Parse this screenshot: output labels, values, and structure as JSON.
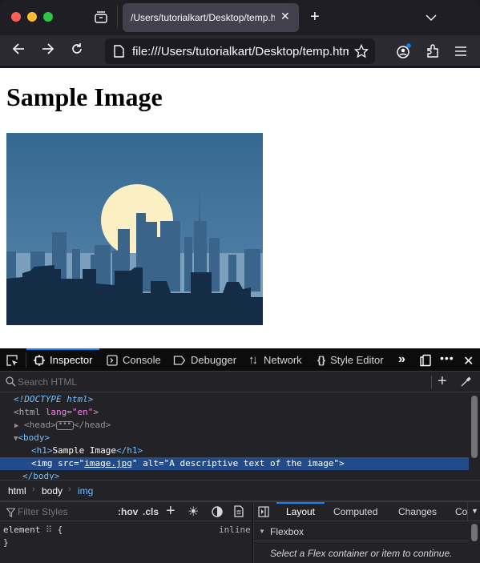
{
  "browser": {
    "tab": {
      "title": "/Users/tutorialkart/Desktop/temp.html"
    },
    "url": "file:///Users/tutorialkart/Desktop/temp.html",
    "traffic_lights": {
      "close": "#ff5f57",
      "minimize": "#febc2e",
      "zoom": "#28c840"
    },
    "icons": [
      "tab-groups-icon",
      "close-icon",
      "new-tab-icon",
      "list-all-tabs-icon",
      "back-icon",
      "forward-icon",
      "reload-icon",
      "page-icon",
      "bookmark-star-icon",
      "account-icon",
      "extensions-icon",
      "menu-icon"
    ],
    "account_badge_color": "#0a84ff"
  },
  "page": {
    "heading": "Sample Image",
    "image_alt": "A descriptive text of the image",
    "image_colors": {
      "sky": "#3c6a8f",
      "moon": "#fbf0c3",
      "buildings": "#2d5478",
      "foreground": "#142c45"
    }
  },
  "devtools": {
    "tabs": [
      {
        "label": "Inspector",
        "selected": true
      },
      {
        "label": "Console"
      },
      {
        "label": "Debugger"
      },
      {
        "label": "Network"
      },
      {
        "label": "Style Editor"
      }
    ],
    "search_placeholder": "Search HTML",
    "markup": {
      "doctype": "<!DOCTYPE html>",
      "html_open": "<html",
      "lang_attr": "lang",
      "lang_val": "\"en\"",
      "head": "<head>",
      "head_close": "</head>",
      "body": "<body>",
      "h1_open": "<h1>",
      "h1_text": "Sample Image",
      "h1_close": "</h1>",
      "img_line_pre": "<img src=\"",
      "img_src": "image.jpg",
      "img_line_post": "\" alt=\"A descriptive text of the image\">",
      "body_close": "</body>"
    },
    "breadcrumbs": [
      "html",
      "body",
      "img"
    ],
    "rules_toolbar": {
      "filter_placeholder": "Filter Styles",
      "hov": ":hov",
      "cls": ".cls"
    },
    "rules": {
      "selector": "element",
      "open": "{",
      "close": "}",
      "source": "inline"
    },
    "side_tabs": [
      {
        "label": "Layout",
        "selected": true
      },
      {
        "label": "Computed"
      },
      {
        "label": "Changes"
      },
      {
        "label": "Co"
      }
    ],
    "flexbox": {
      "title": "Flexbox",
      "message": "Select a Flex container or item to continue."
    }
  }
}
